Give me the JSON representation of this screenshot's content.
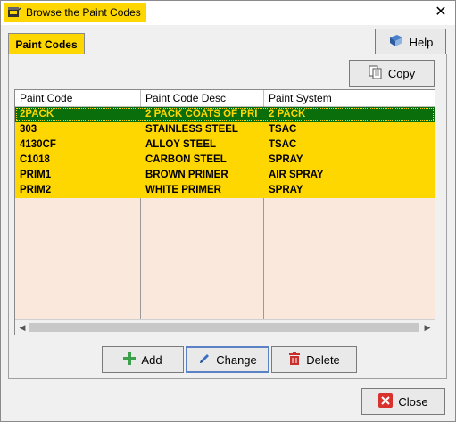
{
  "window": {
    "title": "Browse the Paint Codes",
    "close_glyph": "✕"
  },
  "tab": {
    "label": "Paint Codes"
  },
  "buttons": {
    "help": "Help",
    "copy": "Copy",
    "add": "Add",
    "change": "Change",
    "delete": "Delete",
    "close": "Close"
  },
  "grid": {
    "columns": [
      "Paint Code",
      "Paint Code Desc",
      "Paint System"
    ],
    "rows": [
      [
        "2PACK",
        "2 PACK COATS OF PRI",
        "2 PACK"
      ],
      [
        "303",
        "STAINLESS STEEL",
        "TSAC"
      ],
      [
        "4130CF",
        "ALLOY STEEL",
        "TSAC"
      ],
      [
        "C1018",
        "CARBON STEEL",
        "SPRAY"
      ],
      [
        "PRIM1",
        "BROWN PRIMER",
        "AIR SPRAY"
      ],
      [
        "PRIM2",
        "WHITE PRIMER",
        "SPRAY"
      ]
    ],
    "selected_row": 0
  },
  "colors": {
    "accent_yellow": "#ffd700",
    "selected_green": "#0a6e0a",
    "grid_background": "#fbe8dc"
  },
  "icons": {
    "app": "paint-can-icon",
    "help": "book-icon",
    "copy": "copy-icon",
    "add": "plus-icon",
    "change": "pencil-icon",
    "delete": "trash-icon",
    "close": "red-x-icon"
  }
}
